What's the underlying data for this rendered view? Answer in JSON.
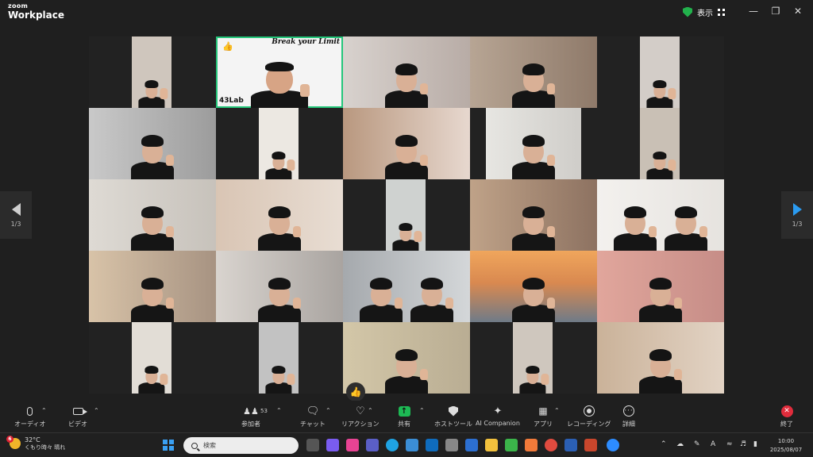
{
  "app": {
    "brand_small": "zoom",
    "brand_large": "Workplace"
  },
  "titlebar": {
    "view_label": "表示"
  },
  "active_tile": {
    "banner": "Break your Limit",
    "logo": "43Lab"
  },
  "pager": {
    "left_label": "1/3",
    "right_label": "1/3"
  },
  "toolbar": {
    "audio": "オーディオ",
    "video": "ビデオ",
    "participants": "参加者",
    "participants_count": "53",
    "chat": "チャット",
    "reactions": "リアクション",
    "share": "共有",
    "host_tools": "ホストツール",
    "ai_companion": "AI Companion",
    "apps": "アプリ",
    "recording": "レコーディング",
    "more": "詳細",
    "end": "終了"
  },
  "taskbar": {
    "temperature": "32°C",
    "weather": "くもり時々 晴れ",
    "weather_badge": "6",
    "search_placeholder": "検索",
    "time": "10:00",
    "date": "2025/08/07"
  },
  "colors": {
    "active_speaker": "#24c67a",
    "share": "#1db954",
    "end": "#e02c3c",
    "next_arrow": "#2b9bf0"
  }
}
